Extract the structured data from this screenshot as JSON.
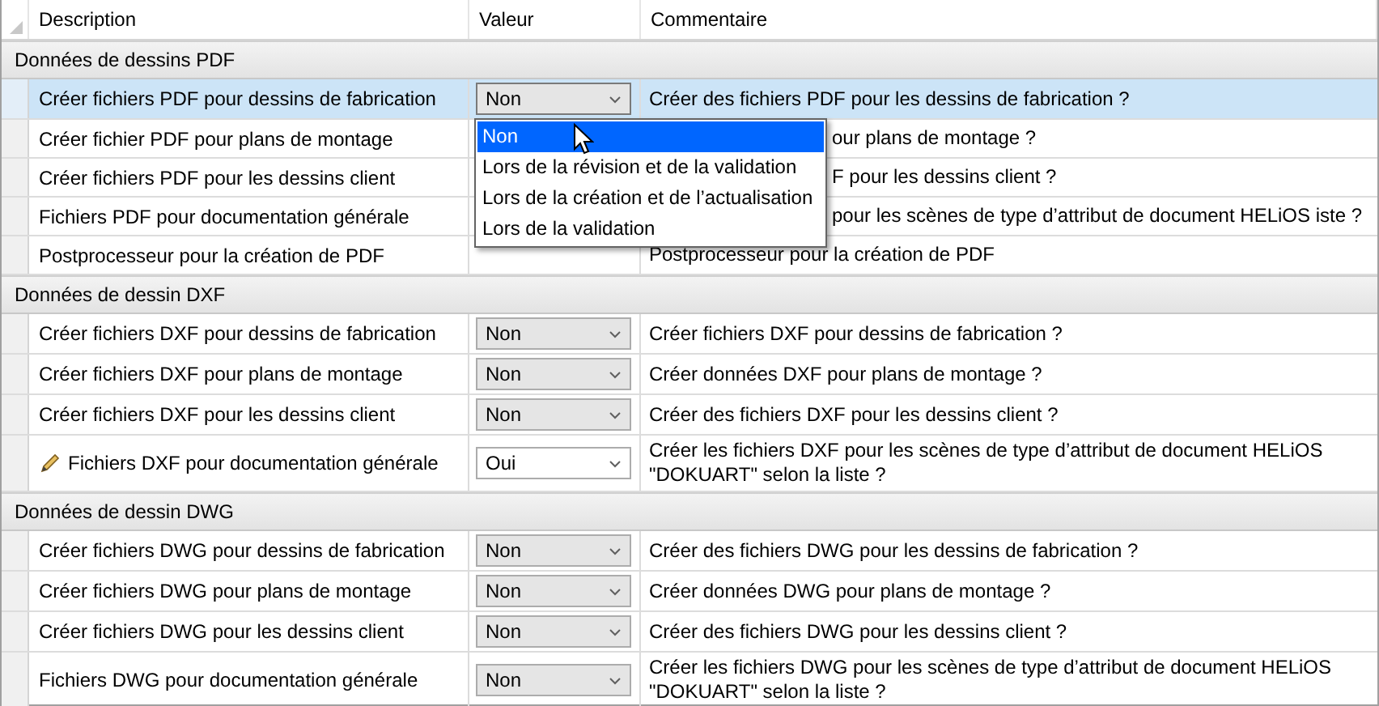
{
  "columns": [
    "Description",
    "Valeur",
    "Commentaire"
  ],
  "groups": [
    {
      "title": "Données de dessins PDF",
      "rows": [
        {
          "description": "Créer fichiers PDF pour dessins de fabrication",
          "selected": true,
          "value": {
            "text": "Non",
            "open": true,
            "options": [
              {
                "label": "Non",
                "selected": true
              },
              {
                "label": "Lors de la révision et de la validation",
                "selected": false
              },
              {
                "label": "Lors de la création et de l’actualisation",
                "selected": false
              },
              {
                "label": "Lors de la validation",
                "selected": false
              }
            ]
          },
          "comment": "Créer des fichiers PDF pour les dessins de fabrication ?"
        },
        {
          "description": "Créer fichier PDF pour plans de montage",
          "selected": false,
          "comment": "our plans de montage ?",
          "covered": true
        },
        {
          "description": "Créer fichiers PDF pour les dessins client",
          "selected": false,
          "comment": "F pour les dessins client ?",
          "covered": true
        },
        {
          "description": "Fichiers PDF pour documentation générale",
          "selected": false,
          "comment": "pour les scènes de type d’attribut de document HELiOS iste ?",
          "covered": true
        },
        {
          "description": "Postprocesseur pour la création de PDF",
          "selected": false,
          "comment": "Postprocesseur pour la création de PDF"
        }
      ]
    },
    {
      "title": "Données de dessin DXF",
      "rows": [
        {
          "description": "Créer fichiers DXF pour dessins de fabrication",
          "selected": false,
          "value": {
            "text": "Non"
          },
          "comment": "Créer fichiers DXF pour dessins de fabrication ?"
        },
        {
          "description": "Créer fichiers DXF pour plans de montage",
          "selected": false,
          "value": {
            "text": "Non"
          },
          "comment": "Créer données DXF pour plans de montage ?"
        },
        {
          "description": "Créer fichiers DXF pour les dessins client",
          "selected": false,
          "value": {
            "text": "Non"
          },
          "comment": "Créer des fichiers DXF pour les dessins client ?"
        },
        {
          "description": "Fichiers DXF pour documentation générale",
          "selected": false,
          "modified": true,
          "value": {
            "text": "Oui"
          },
          "comment": "Créer les fichiers DXF pour les scènes de type d’attribut de document HELiOS \"DOKUART\" selon la liste ?"
        }
      ]
    },
    {
      "title": "Données de dessin DWG",
      "rows": [
        {
          "description": "Créer fichiers DWG pour dessins de fabrication",
          "selected": false,
          "value": {
            "text": "Non"
          },
          "comment": "Créer des fichiers DWG pour les dessins de fabrication ?"
        },
        {
          "description": "Créer fichiers DWG pour plans de montage",
          "selected": false,
          "value": {
            "text": "Non"
          },
          "comment": "Créer données DWG pour plans de montage ?"
        },
        {
          "description": "Créer fichiers DWG pour les dessins client",
          "selected": false,
          "value": {
            "text": "Non"
          },
          "comment": "Créer des fichiers DWG pour les dessins client ?"
        },
        {
          "description": "Fichiers DWG pour documentation générale",
          "selected": false,
          "value": {
            "text": "Non"
          },
          "comment": "Créer les fichiers DWG pour les scènes de type d’attribut de document HELiOS \"DOKUART\" selon la liste ?"
        }
      ]
    }
  ]
}
